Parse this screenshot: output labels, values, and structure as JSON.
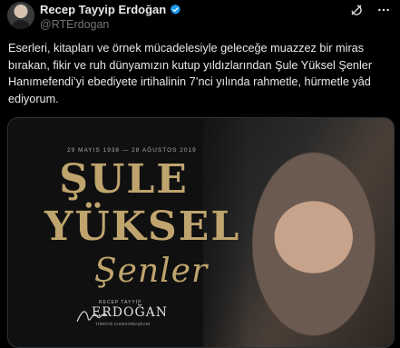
{
  "user": {
    "display_name": "Recep Tayyip Erdoğan",
    "handle": "@RTErdogan",
    "avatar_icon": "avatar-image",
    "verified_icon": "verified-badge-icon"
  },
  "tweet": {
    "text": "Eserleri, kitapları ve örnek mücadelesiyle geleceğe muazzez bir miras bırakan, fikir ve ruh dünyamızın kutup yıldızlarından Şule Yüksel Şenler Hanımefendi’yi ebediyete irtihalinin 7’nci yılında rahmetle, hürmetle yâd ediyorum."
  },
  "media": {
    "dates": "29 MAYIS 1938 — 28 AĞUSTOS 2019",
    "title_line1": "ŞULE",
    "title_line2": "YÜKSEL",
    "script_name": "Şenler",
    "signature_top": "RECEP TAYYİP",
    "signature_name": "ERDOĞAN",
    "signature_sub": "TÜRKİYE CUMHURBAŞKANI"
  },
  "colors": {
    "accent_gold": "#bfa46e",
    "verified_blue": "#1d9bf0"
  }
}
